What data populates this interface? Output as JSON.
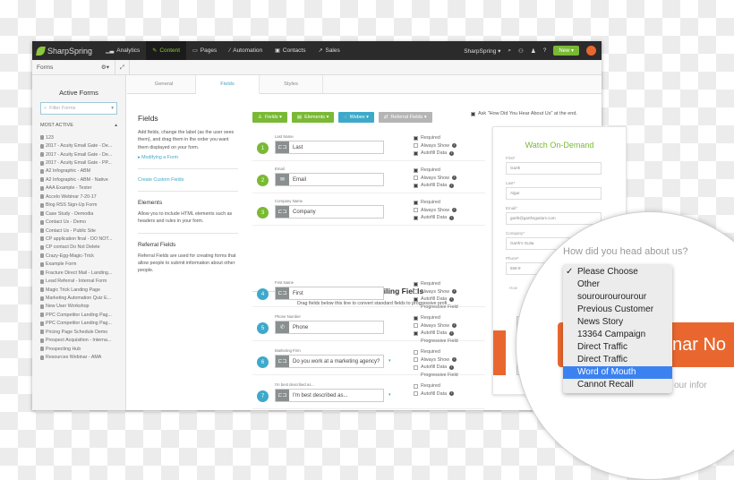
{
  "topbar": {
    "brand": "SharpSpring",
    "nav": [
      {
        "label": "Analytics",
        "icon": "chart-icon"
      },
      {
        "label": "Content",
        "icon": "pencil-icon",
        "active": true
      },
      {
        "label": "Pages",
        "icon": "window-icon"
      },
      {
        "label": "Automation",
        "icon": "wand-icon"
      },
      {
        "label": "Contacts",
        "icon": "contact-card-icon"
      },
      {
        "label": "Sales",
        "icon": "trend-icon"
      }
    ],
    "account": "SharpSpring ▾",
    "new_label": "New ▾"
  },
  "subbar": {
    "title": "Forms"
  },
  "sidebar": {
    "heading": "Active Forms",
    "filter_placeholder": "Filter Forms",
    "section": "MOST ACTIVE",
    "forms": [
      "123",
      "2017 - Acuity Email Gate - De...",
      "2017 - Acuity Email Gate - De...",
      "2017 - Acuity Email Gate - PP...",
      "A2 Infographic - ABM",
      "A2 Infographic - ABM - Native",
      "AAA Example - Tester",
      "Accelo Webinar 7-20-17",
      "Blog RSS Sign-Up Form",
      "Case Study - Demodia",
      "Contact Us - Demo",
      "Contact Us - Public Site",
      "CP application final - DO NOT...",
      "CP contact Do Not Delete",
      "Crazy-Egg-Magic-Trick",
      "Example Form",
      "Fracture Direct Mail - Landing...",
      "Lead Referral - Internal Form",
      "Magic Trick Landing Page",
      "Marketing Automation Quiz E...",
      "New User Workshop",
      "PPC Competitor Landing Pag...",
      "PPC Competitor Landing Pag...",
      "Pricing Page Schedule Demo",
      "Prospect Acquisition - Interna...",
      "Prospecting Hub",
      "Resources Webinar - AMA"
    ]
  },
  "tabs": [
    "General",
    "Fields",
    "Styles"
  ],
  "help": {
    "fields_title": "Fields",
    "fields_text": "Add fields, change the label (as the user sees them), and drag them in the order you want them displayed on your form.",
    "modifying_link": "▸ Modifying a Form",
    "custom_link": "Create Custom Fields",
    "elements_title": "Elements",
    "elements_text": "Allow you to include HTML elements such as headers and rules in your form.",
    "referral_title": "Referral Fields",
    "referral_text": "Referral Fields are used for creating forms that allow people to submit information about other people."
  },
  "toolbar": {
    "fields": "Fields ▾",
    "elements": "Elements ▾",
    "webex": "Webex ▾",
    "referral": "Referral Fields ▾",
    "ask_hear": "Ask \"How Did You Hear About Us\" at the end."
  },
  "fields": [
    {
      "n": "1",
      "label": "Last Name",
      "value": "Last",
      "icon": "text-field-icon",
      "required": true,
      "always": false,
      "autofill": true
    },
    {
      "n": "2",
      "label": "Email",
      "value": "Email",
      "icon": "envelope-icon",
      "required": true,
      "always": false,
      "autofill": true
    },
    {
      "n": "3",
      "label": "Company Name",
      "value": "Company",
      "icon": "text-field-icon",
      "required": true,
      "always": false,
      "autofill": true
    },
    {
      "n": "4",
      "label": "First Name",
      "value": "First",
      "icon": "text-field-icon",
      "required": true,
      "always": false,
      "autofill": true,
      "progressive": true
    },
    {
      "n": "5",
      "label": "Phone Number",
      "value": "Phone",
      "icon": "phone-icon",
      "required": true,
      "always": false,
      "autofill": true,
      "progressive": true
    },
    {
      "n": "6",
      "label": "Marketing Firm",
      "value": "Do you work at a marketing agency?",
      "icon": "text-field-icon",
      "required": false,
      "always": false,
      "autofill": false,
      "progressive": true,
      "dropdown": true
    },
    {
      "n": "7",
      "label": "I'm best described as...",
      "value": "I'm best described as...",
      "icon": "text-field-icon",
      "required": false,
      "autofill": false,
      "dropdown": true
    }
  ],
  "option_labels": {
    "required": "Required",
    "always": "Always Show",
    "autofill": "Autofill Data",
    "progressive": "Progressive Field"
  },
  "progressive": {
    "title": "Progressive Profiling Fields",
    "subtitle": "Drag fields below this line to convert standard fields to progressive profi"
  },
  "preview": {
    "title": "Watch On-Demand",
    "fields": [
      {
        "label": "First*",
        "value": "Garth"
      },
      {
        "label": "Last*",
        "value": "Algar"
      },
      {
        "label": "Email*",
        "value": "garth@garthsguitars.com"
      },
      {
        "label": "Company*",
        "value": "Garth's Guita"
      },
      {
        "label": "Phone*",
        "value": "555-9"
      }
    ],
    "question": "How"
  },
  "magnifier": {
    "question": "How did you head about us?",
    "button": "nar No",
    "info": "our infor",
    "options": [
      "Please Choose",
      "Other",
      "sourourourourour",
      "Previous Customer",
      "News Story",
      "13364 Campaign",
      "Direct Traffic",
      "Direct Traffic",
      "Word of Mouth",
      "Cannot Recall"
    ],
    "checked_index": 0,
    "highlighted_index": 8
  },
  "colors": {
    "green": "#7ab934",
    "blue": "#3ea9c9",
    "orange": "#e9672e",
    "highlight": "#3b82f1"
  }
}
